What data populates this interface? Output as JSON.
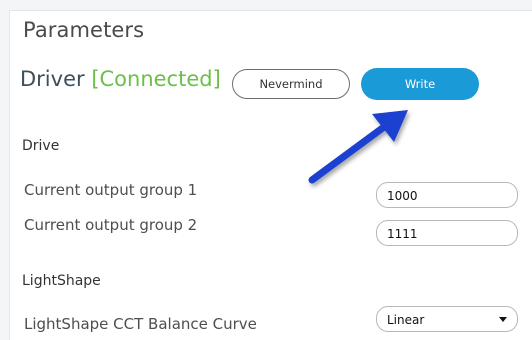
{
  "header": {
    "title": "Parameters"
  },
  "driver": {
    "label": "Driver",
    "status": "[Connected]",
    "status_color": "#6cc04a"
  },
  "actions": {
    "nevermind_label": "Nevermind",
    "write_label": "Write",
    "write_color": "#1a9ad6"
  },
  "annotation": {
    "arrow_icon": "arrow-pointing-to-write-button",
    "arrow_color": "#1f3fcf"
  },
  "sections": {
    "drive": {
      "title": "Drive",
      "fields": [
        {
          "label": "Current output group 1",
          "value": "1000"
        },
        {
          "label": "Current output group 2",
          "value": "1111"
        }
      ]
    },
    "lightshape": {
      "title": "LightShape",
      "fields": [
        {
          "label": "LightShape CCT Balance Curve",
          "value": "Linear"
        }
      ]
    }
  }
}
